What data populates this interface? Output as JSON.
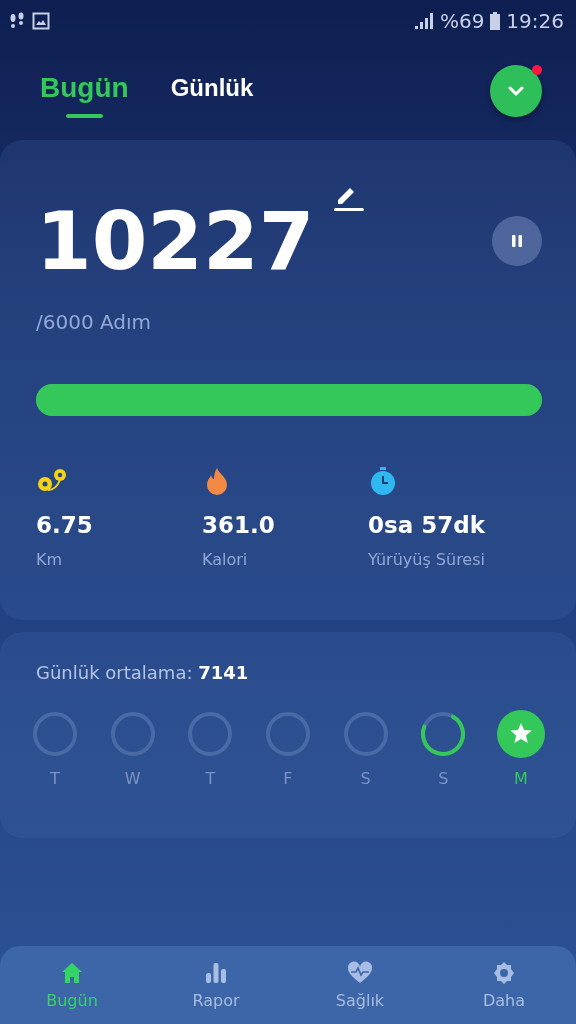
{
  "status_bar": {
    "battery": "%69",
    "time": "19:26"
  },
  "tabs": [
    {
      "label": "Bugün",
      "selected": true
    },
    {
      "label": "Günlük",
      "selected": false
    }
  ],
  "notification": {
    "unread": true
  },
  "steps": {
    "count": "10227",
    "goal": "/6000 Adım",
    "paused": false,
    "level": 1
  },
  "stats": [
    {
      "kind": "distance",
      "value": "6.75",
      "label": "Km"
    },
    {
      "kind": "calories",
      "value": "361.0",
      "label": "Kalori"
    },
    {
      "kind": "duration",
      "value": "0sa 57dk",
      "label": "Yürüyüş Süresi"
    }
  ],
  "weekly": {
    "average_label": "Günlük ortalama:",
    "average_value": "7141",
    "days": [
      {
        "label": "T",
        "kind": "empty",
        "selected": false
      },
      {
        "label": "W",
        "kind": "empty",
        "selected": false
      },
      {
        "label": "T",
        "kind": "empty",
        "selected": false
      },
      {
        "label": "F",
        "kind": "empty",
        "selected": false
      },
      {
        "label": "S",
        "kind": "empty",
        "selected": false
      },
      {
        "label": "S",
        "kind": "partial",
        "selected": false
      },
      {
        "label": "M",
        "kind": "goal",
        "selected": true
      }
    ]
  },
  "nav": [
    {
      "kind": "home",
      "label": "Bugün",
      "selected": true
    },
    {
      "kind": "chart",
      "label": "Rapor",
      "selected": false
    },
    {
      "kind": "heart",
      "label": "Sağlık",
      "selected": false
    },
    {
      "kind": "gear",
      "label": "Daha",
      "selected": false
    }
  ]
}
